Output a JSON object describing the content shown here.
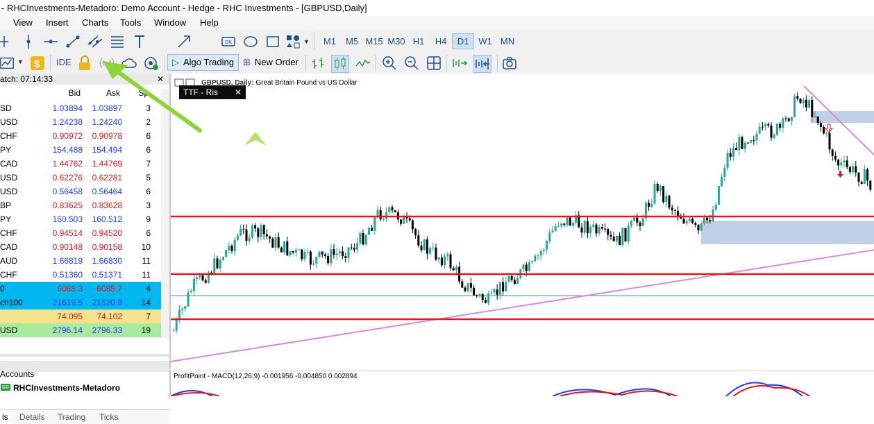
{
  "window": {
    "title": "- RHCInvestments-Metadoro: Demo Account - Hedge - RHC Investments - [GBPUSD,Daily]"
  },
  "menu": [
    "View",
    "Insert",
    "Charts",
    "Tools",
    "Window",
    "Help"
  ],
  "toolbar1": {
    "timeframes": [
      "M1",
      "M5",
      "M15",
      "M30",
      "H1",
      "H4",
      "D1",
      "W1",
      "MN"
    ],
    "active_timeframe": "D1",
    "tool_icons": [
      "crosshair-icon",
      "vertical-line-icon",
      "horizontal-line-icon",
      "trend-line-icon",
      "channel-icon",
      "fibonacci-icon",
      "text-icon",
      "arrow-icon",
      "ok-label-icon",
      "ellipse-icon",
      "rectangle-icon",
      "shapes-icon"
    ]
  },
  "toolbar2": {
    "ide_label": "IDE",
    "algo_trading_label": "Algo Trading",
    "new_order_label": "New Order"
  },
  "market_watch": {
    "header": "atch: 07:14:33",
    "columns": {
      "bid": "Bid",
      "ask": "Ask",
      "spread": "Sp"
    },
    "rows": [
      {
        "symbol": "SD",
        "bid": "1.03894",
        "ask": "1.03897",
        "spread": "3",
        "dir": "up",
        "bg": ""
      },
      {
        "symbol": "USD",
        "bid": "1.24238",
        "ask": "1.24240",
        "spread": "2",
        "dir": "up",
        "bg": ""
      },
      {
        "symbol": "CHF",
        "bid": "0.90972",
        "ask": "0.90978",
        "spread": "6",
        "dir": "dn",
        "bg": ""
      },
      {
        "symbol": "PY",
        "bid": "154.488",
        "ask": "154.494",
        "spread": "6",
        "dir": "up",
        "bg": ""
      },
      {
        "symbol": "CAD",
        "bid": "1.44762",
        "ask": "1.44769",
        "spread": "7",
        "dir": "dn",
        "bg": ""
      },
      {
        "symbol": "USD",
        "bid": "0.62276",
        "ask": "0.62281",
        "spread": "5",
        "dir": "dn",
        "bg": ""
      },
      {
        "symbol": "USD",
        "bid": "0.56458",
        "ask": "0.56464",
        "spread": "6",
        "dir": "up",
        "bg": ""
      },
      {
        "symbol": "BP",
        "bid": "0.83625",
        "ask": "0.83628",
        "spread": "3",
        "dir": "dn",
        "bg": ""
      },
      {
        "symbol": "PY",
        "bid": "160.503",
        "ask": "160.512",
        "spread": "9",
        "dir": "up",
        "bg": ""
      },
      {
        "symbol": "CHF",
        "bid": "0.94514",
        "ask": "0.94520",
        "spread": "6",
        "dir": "dn",
        "bg": ""
      },
      {
        "symbol": "CAD",
        "bid": "0.90148",
        "ask": "0.90158",
        "spread": "10",
        "dir": "dn",
        "bg": ""
      },
      {
        "symbol": "AUD",
        "bid": "1.66819",
        "ask": "1.66830",
        "spread": "11",
        "dir": "up",
        "bg": ""
      },
      {
        "symbol": "CHF",
        "bid": "0.51360",
        "ask": "0.51371",
        "spread": "11",
        "dir": "up",
        "bg": ""
      },
      {
        "symbol": "0",
        "bid": "6085.3",
        "ask": "6085.7",
        "spread": "4",
        "dir": "dn",
        "bg": "#00b7f0"
      },
      {
        "symbol": "ch100",
        "bid": "21619.5",
        "ask": "21620.9",
        "spread": "14",
        "dir": "up",
        "bg": "#00b7f0"
      },
      {
        "symbol": "",
        "bid": "74.095",
        "ask": "74.102",
        "spread": "7",
        "dir": "dn",
        "bg": "#f5e28c"
      },
      {
        "symbol": "USD",
        "bid": "2796.14",
        "ask": "2796.33",
        "spread": "19",
        "dir": "up",
        "bg": "#a9eb9e"
      }
    ],
    "tabs": [
      "ls",
      "Details",
      "Trading",
      "Ticks"
    ]
  },
  "navigator": {
    "accounts_label": "Accounts",
    "account_name": "RHCInvestments-Metadoro"
  },
  "chart": {
    "symbol_label": "GBPUSD, Daily:",
    "description": "Great Britain Pound vs US Dollar",
    "ttf_label": "TTF - Ris",
    "indicator_label": "ProfitPoint - MACD(12,26,9) -0.001956 -0.004850 0.002894",
    "colors": {
      "bull": "#26a69a",
      "bear": "#000000",
      "level": "#e1161e",
      "trend": "#d58bd8",
      "zone": "#b8cbe3"
    }
  }
}
